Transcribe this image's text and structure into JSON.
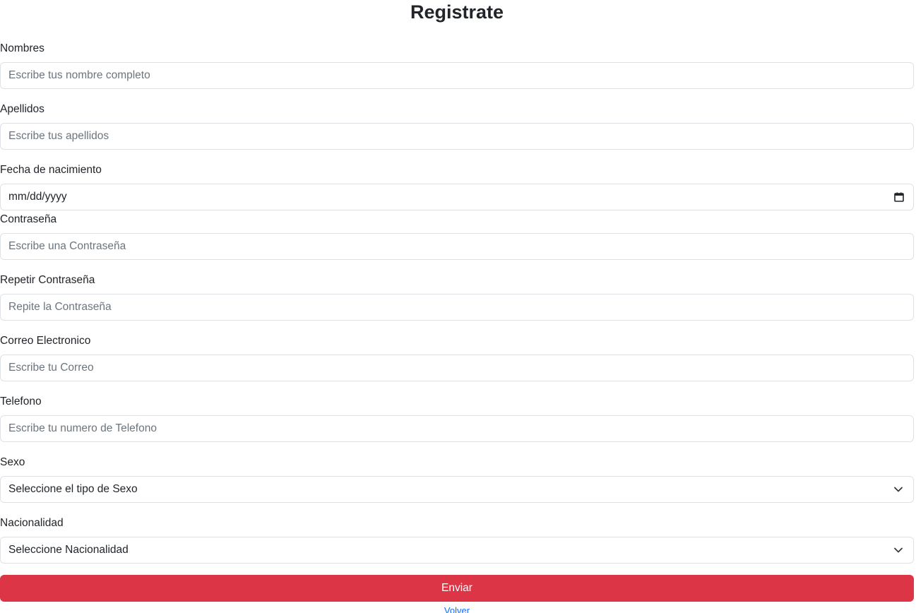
{
  "page": {
    "title": "Registrate"
  },
  "form": {
    "nombres": {
      "label": "Nombres",
      "placeholder": "Escribe tus nombre completo"
    },
    "apellidos": {
      "label": "Apellidos",
      "placeholder": "Escribe tus apellidos"
    },
    "fecha": {
      "label": "Fecha de nacimiento",
      "value": "mm/dd/yyyy",
      "icon": "calendar-icon"
    },
    "contrasena": {
      "label": "Contraseña",
      "placeholder": "Escribe una Contraseña"
    },
    "repetir": {
      "label": "Repetir Contraseña",
      "placeholder": "Repite la Contraseña"
    },
    "correo": {
      "label": "Correo Electronico",
      "placeholder": "Escribe tu Correo"
    },
    "telefono": {
      "label": "Telefono",
      "placeholder": "Escribe tu numero de Telefono"
    },
    "sexo": {
      "label": "Sexo",
      "selected": "Seleccione el tipo de Sexo",
      "icon": "chevron-down-icon"
    },
    "nacionalidad": {
      "label": "Nacionalidad",
      "selected": "Seleccione Nacionalidad",
      "icon": "chevron-down-icon"
    },
    "submit_label": "Enviar",
    "back_label": "Volver"
  },
  "colors": {
    "submit_background": "#dc3545",
    "link": "#0d6efd",
    "input_border": "#dee2e6"
  }
}
